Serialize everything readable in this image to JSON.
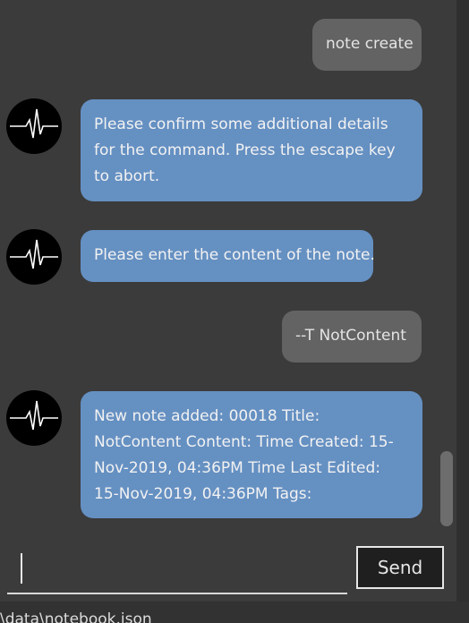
{
  "messages": [
    {
      "sender": "user",
      "text": "note create"
    },
    {
      "sender": "bot",
      "text": "Please confirm some additional details for the command. Press the escape key to abort."
    },
    {
      "sender": "bot",
      "text": "Please enter the content of the note."
    },
    {
      "sender": "user",
      "text": "--T NotContent"
    },
    {
      "sender": "bot",
      "text": "New note added: 00018 Title: NotContent Content:  Time Created: 15-Nov-2019, 04:36PM Time Last Edited: 15-Nov-2019, 04:36PM Tags:"
    }
  ],
  "input": {
    "value": "",
    "placeholder": ""
  },
  "send_button": {
    "label": "Send"
  },
  "status_bar": {
    "path": "\\data\\notebook.json"
  },
  "colors": {
    "background": "#3b3b3b",
    "user_bubble": "#636363",
    "bot_bubble": "#6590c2",
    "avatar": "#000000"
  },
  "icons": {
    "avatar": "heartbeat-icon"
  }
}
